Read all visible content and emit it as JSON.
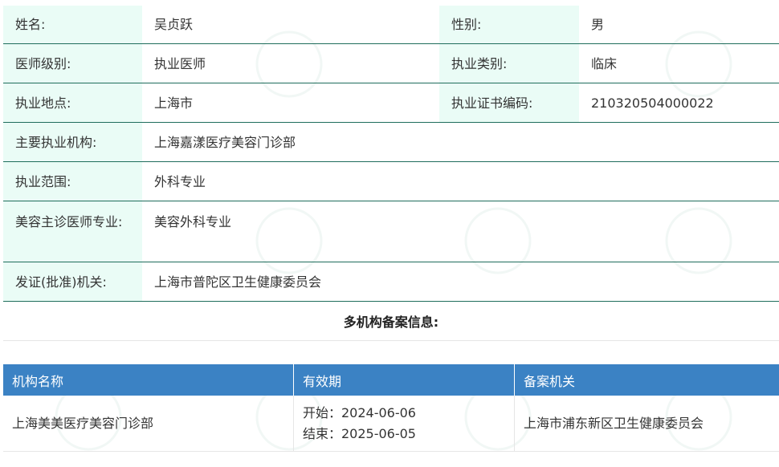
{
  "doctor_info": {
    "rows": [
      {
        "cells": [
          {
            "label": "姓名:",
            "value": "吴贞跃"
          },
          {
            "label": "性别:",
            "value": "男"
          }
        ]
      },
      {
        "cells": [
          {
            "label": "医师级别:",
            "value": "执业医师"
          },
          {
            "label": "执业类别:",
            "value": "临床"
          }
        ]
      },
      {
        "cells": [
          {
            "label": "执业地点:",
            "value": "上海市"
          },
          {
            "label": "执业证书编码:",
            "value": "210320504000022"
          }
        ]
      },
      {
        "cells": [
          {
            "label": "主要执业机构:",
            "value": "上海嘉漾医疗美容门诊部"
          }
        ]
      },
      {
        "cells": [
          {
            "label": "执业范围:",
            "value": "外科专业"
          }
        ]
      },
      {
        "cells": [
          {
            "label": "美容主诊医师专业:",
            "value": "美容外科专业"
          }
        ]
      },
      {
        "cells": [
          {
            "label": "发证(批准)机关:",
            "value": "上海市普陀区卫生健康委员会"
          }
        ]
      }
    ]
  },
  "multi_org": {
    "title": "多机构备案信息:",
    "headers": [
      "机构名称",
      "有效期",
      "备案机关"
    ],
    "rows": [
      {
        "org": "上海美美医疗美容门诊部",
        "start": "开始：2024-06-06",
        "end": "结束：2025-06-05",
        "authority": "上海市浦东新区卫生健康委员会"
      }
    ]
  },
  "colors": {
    "label_bg": "#eafcf6",
    "row_border": "#1f6d5c",
    "header_bg": "#3b82c4"
  }
}
